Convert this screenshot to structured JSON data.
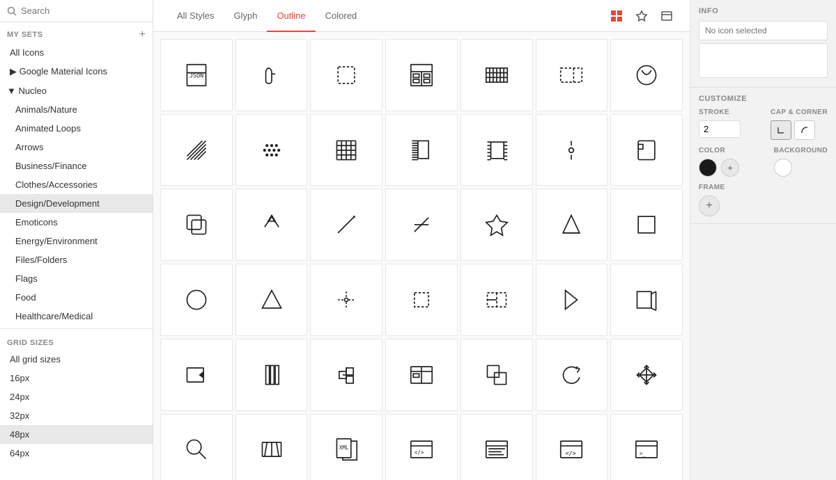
{
  "sidebar": {
    "search_placeholder": "Search",
    "my_sets_label": "MY SETS",
    "add_btn_label": "+",
    "items": [
      {
        "label": "All Icons",
        "id": "all-icons",
        "active": false,
        "indent": 0
      },
      {
        "label": "▶ Google Material Icons",
        "id": "google-material",
        "active": false,
        "indent": 0
      },
      {
        "label": "▼ Nucleo",
        "id": "nucleo",
        "active": false,
        "indent": 0
      },
      {
        "label": "Animals/Nature",
        "id": "animals",
        "active": false,
        "indent": 1
      },
      {
        "label": "Animated Loops",
        "id": "animated",
        "active": false,
        "indent": 1
      },
      {
        "label": "Arrows",
        "id": "arrows",
        "active": false,
        "indent": 1
      },
      {
        "label": "Business/Finance",
        "id": "business",
        "active": false,
        "indent": 1
      },
      {
        "label": "Clothes/Accessories",
        "id": "clothes",
        "active": false,
        "indent": 1
      },
      {
        "label": "Design/Development",
        "id": "design",
        "active": true,
        "indent": 1
      },
      {
        "label": "Emoticons",
        "id": "emoticons",
        "active": false,
        "indent": 1
      },
      {
        "label": "Energy/Environment",
        "id": "energy",
        "active": false,
        "indent": 1
      },
      {
        "label": "Files/Folders",
        "id": "files",
        "active": false,
        "indent": 1
      },
      {
        "label": "Flags",
        "id": "flags",
        "active": false,
        "indent": 1
      },
      {
        "label": "Food",
        "id": "food",
        "active": false,
        "indent": 1
      },
      {
        "label": "Healthcare/Medical",
        "id": "healthcare",
        "active": false,
        "indent": 1
      }
    ],
    "grid_sizes_label": "GRID SIZES",
    "grid_sizes": [
      {
        "label": "All grid sizes",
        "id": "all-sizes",
        "active": false
      },
      {
        "label": "16px",
        "id": "16px",
        "active": false
      },
      {
        "label": "24px",
        "id": "24px",
        "active": false
      },
      {
        "label": "32px",
        "id": "32px",
        "active": false
      },
      {
        "label": "48px",
        "id": "48px",
        "active": true
      },
      {
        "label": "64px",
        "id": "64px",
        "active": false
      }
    ]
  },
  "topnav": {
    "tabs": [
      {
        "label": "All Styles",
        "id": "all-styles",
        "active": false
      },
      {
        "label": "Glyph",
        "id": "glyph",
        "active": false
      },
      {
        "label": "Outline",
        "id": "outline",
        "active": true
      },
      {
        "label": "Colored",
        "id": "colored",
        "active": false
      }
    ]
  },
  "right_panel": {
    "info_label": "INFO",
    "no_icon_placeholder": "No icon selected",
    "customize_label": "CUSTOMIZE",
    "stroke_label": "STROKE",
    "stroke_value": "2",
    "cap_corner_label": "CAP & CORNER",
    "color_label": "COLOR",
    "background_label": "BACKGROUND",
    "frame_label": "FRAME"
  }
}
